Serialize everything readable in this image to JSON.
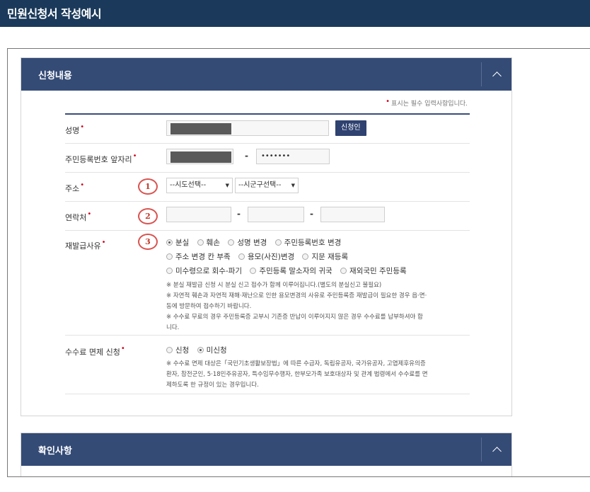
{
  "header": {
    "title": "민원신청서 작성예시"
  },
  "panel1": {
    "title": "신청내용",
    "required_note": "표시는 필수 입력사항입니다.",
    "name": {
      "label": "성명",
      "button": "신청인"
    },
    "rrn": {
      "label": "주민등록번호 앞자리",
      "dash": "-",
      "back_value": "•••••••"
    },
    "address": {
      "label": "주소",
      "marker": "1",
      "sido": "--시도선택--",
      "sigungu": "--시군구선택--"
    },
    "contact": {
      "label": "연락처",
      "marker": "2",
      "dash1": "-",
      "dash2": "-"
    },
    "reason": {
      "label": "재발급사유",
      "marker": "3",
      "options_line1": [
        "분실",
        "훼손",
        "성명 변경",
        "주민등록번호 변경"
      ],
      "options_line2": [
        "주소 변경 칸 부족",
        "용모(사진)변경",
        "지문 재등록"
      ],
      "options_line3": [
        "미수령으로 회수-파기",
        "주민등록 말소자의 귀국",
        "재외국민 주민등록"
      ],
      "selected": "분실",
      "notes": [
        "※ 분실 재발급 신청 시 분실 신고 접수가 함께 이루어집니다.(별도의 분실신고 불필요)",
        "※ 자연적 훼손과 자연적 재해·재난으로 인한 용모변경의 사유로 주민등록증 재발급이 필요한 경우 읍·면·",
        "동에 방문하여 접수하기 바랍니다.",
        "※ 수수료 무료의 경우 주민등록증 교부시 기존증 반납이 이루어지지 않은 경우 수수료를 납부하셔야 합",
        "니다."
      ]
    },
    "fee": {
      "label": "수수료 면제 신청",
      "options": [
        "신청",
        "미신청"
      ],
      "selected": "미신청",
      "notes": [
        "※ 수수료 면제 대상은「국민기초생활보장법」에 따른 수급자, 독립유공자, 국가유공자, 고엽제후유의증",
        "환자, 참전군인, 5·18민주유공자, 특수임무수행자, 한부모가족 보호대상자 및 관계 법령에서 수수료를 면",
        "제하도록 한 규정이 있는 경우입니다."
      ]
    }
  },
  "panel2": {
    "title": "확인사항"
  },
  "colors": {
    "header_bg": "#1b3a5b",
    "panel_head_bg": "#344b76",
    "required": "#d0021b",
    "marker": "#d9534f"
  },
  "icons": {
    "collapse": "chevron-up-icon"
  }
}
